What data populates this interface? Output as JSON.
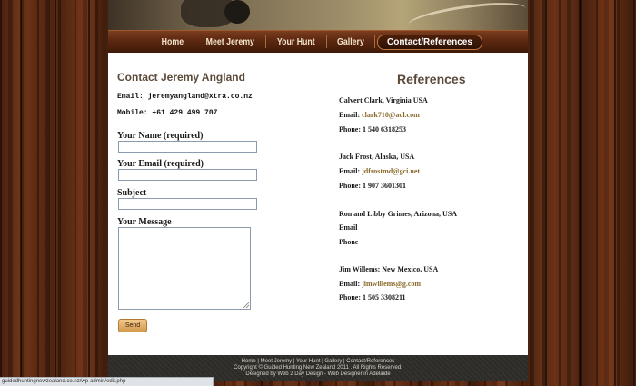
{
  "nav": {
    "items": [
      {
        "label": "Home"
      },
      {
        "label": "Meet Jeremy"
      },
      {
        "label": "Your Hunt"
      },
      {
        "label": "Gallery"
      },
      {
        "label": "Contact/References"
      }
    ]
  },
  "contact": {
    "title": "Contact Jeremy Angland",
    "email_line": "Email: jeremyangland@xtra.co.nz",
    "mobile_line": "Mobile: +61 429 499 707"
  },
  "form": {
    "name_label": "Your Name (required)",
    "email_label": "Your Email (required)",
    "subject_label": "Subject",
    "message_label": "Your Message",
    "send_label": "Send"
  },
  "references": {
    "title": "References",
    "entries": [
      {
        "name": "Calvert Clark, Virginia USA",
        "email_label": "Email:",
        "email": "clark710@aol.com",
        "phone_label": "Phone:",
        "phone": "1 540 6318253"
      },
      {
        "name": "Jack Frost, Alaska, USA",
        "email_label": "Email:",
        "email": "jdfrostmd@gci.net",
        "phone_label": "Phone:",
        "phone": "1 907 3601301"
      },
      {
        "name": "Ron and Libby Grimes, Arizona, USA",
        "email_label": "Email",
        "email": "",
        "phone_label": "Phone",
        "phone": ""
      },
      {
        "name": "Jim Willems: New Mexico, USA",
        "email_label": "Email:",
        "email": "jimwillems@g.com",
        "phone_label": "Phone:",
        "phone": "1 505 3308211"
      }
    ]
  },
  "footer": {
    "links": "Home | Meet Jeremy | Your Hunt | Gallery | Contact/References",
    "copyright": "Copyright © Guided Hunting New Zealand 2011 . All Rights Reserved.",
    "designer": "Designed by Web 2 Day Design - Web Designer in Adelaide"
  },
  "status_bar": {
    "url": "guidedhuntingnewzealand.co.nz/wp-admin/edit.php"
  },
  "colors": {
    "accent_link": "#8a6a2a",
    "nav_bg": "#5c2810",
    "footer_bg": "#2c2b28"
  }
}
